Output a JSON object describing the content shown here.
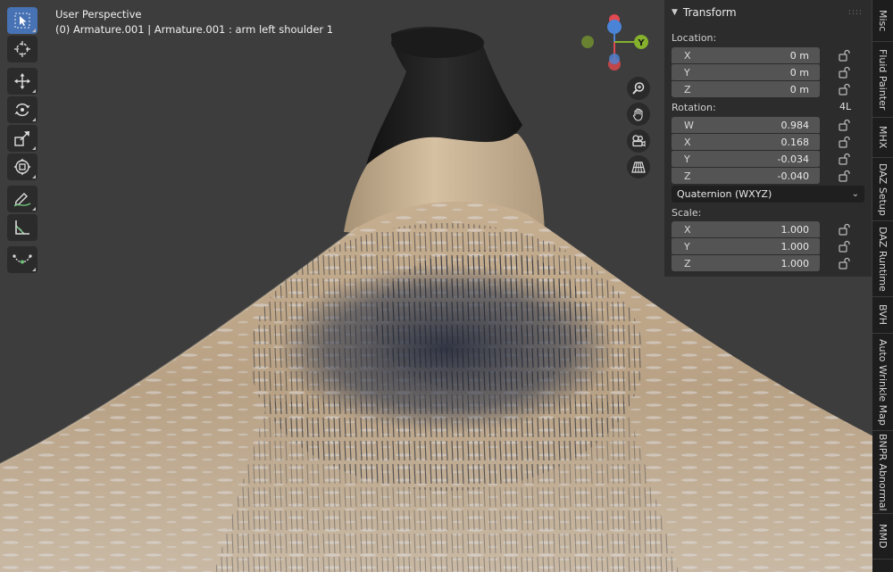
{
  "viewport": {
    "title": "User Perspective",
    "subtitle": "(0) Armature.001 | Armature.001 : arm left shoulder 1"
  },
  "toolbar": [
    {
      "name": "select-box-tool",
      "icon": "cursor-select-icon",
      "active": true
    },
    {
      "name": "cursor-tool",
      "icon": "3d-cursor-icon"
    },
    {
      "name": "move-tool",
      "icon": "move-arrows-icon"
    },
    {
      "name": "rotate-tool",
      "icon": "rotate-icon"
    },
    {
      "name": "scale-tool",
      "icon": "scale-icon"
    },
    {
      "name": "transform-tool",
      "icon": "transform-icon"
    },
    {
      "name": "annotate-tool",
      "icon": "pencil-icon"
    },
    {
      "name": "measure-tool",
      "icon": "ruler-icon"
    },
    {
      "name": "curve-tool",
      "icon": "curve-icon"
    }
  ],
  "gizmo": {
    "y_label": "Y"
  },
  "transform": {
    "header": "Transform",
    "location_label": "Location:",
    "location": [
      {
        "axis": "X",
        "value": "0 m"
      },
      {
        "axis": "Y",
        "value": "0 m"
      },
      {
        "axis": "Z",
        "value": "0 m"
      }
    ],
    "rotation_label": "Rotation:",
    "rotation_mode_short": "4L",
    "rotation": [
      {
        "axis": "W",
        "value": "0.984"
      },
      {
        "axis": "X",
        "value": "0.168"
      },
      {
        "axis": "Y",
        "value": "-0.034"
      },
      {
        "axis": "Z",
        "value": "-0.040"
      }
    ],
    "rotation_mode": "Quaternion (WXYZ)",
    "scale_label": "Scale:",
    "scale": [
      {
        "axis": "X",
        "value": "1.000"
      },
      {
        "axis": "Y",
        "value": "1.000"
      },
      {
        "axis": "Z",
        "value": "1.000"
      }
    ]
  },
  "tabs": [
    "Misc",
    "Fluid Painter",
    "MHX",
    "DAZ Setup",
    "DAZ Runtime",
    "BVH",
    "Auto Wrinkle Map",
    "BNPR Abnormal",
    "MMD"
  ],
  "colors": {
    "accent": "#4772b3",
    "axis_x": "#e0494f",
    "axis_y": "#86b12c",
    "axis_z": "#4b84d6",
    "skin": "#c4ac8e",
    "hair": "#2e3444"
  }
}
